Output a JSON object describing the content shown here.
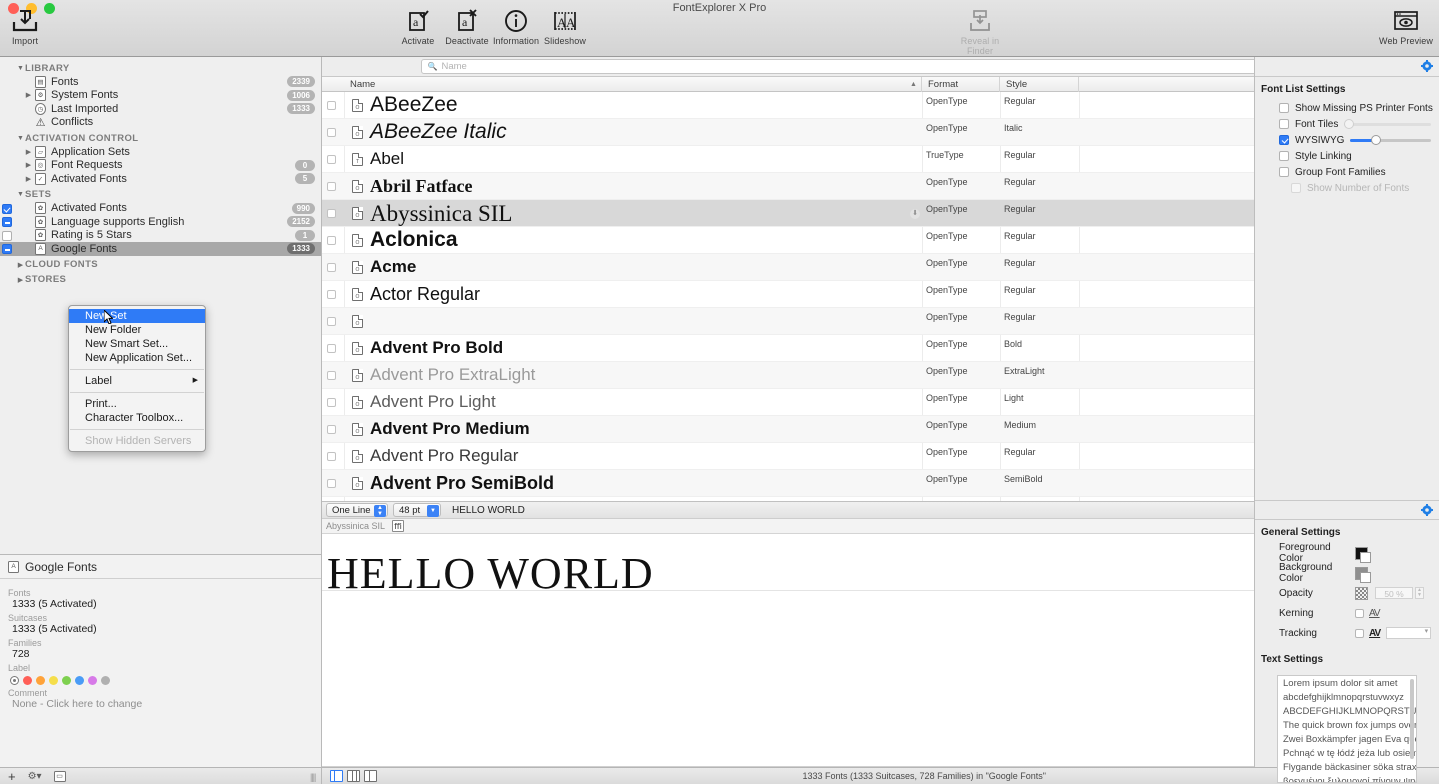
{
  "window": {
    "title": "FontExplorer X Pro"
  },
  "toolbar": {
    "items": [
      {
        "label": "Import",
        "icon": "import-icon",
        "enabled": true
      },
      {
        "label": "Activate",
        "icon": "activate-icon",
        "enabled": true
      },
      {
        "label": "Deactivate",
        "icon": "deactivate-icon",
        "enabled": true
      },
      {
        "label": "Information",
        "icon": "information-icon",
        "enabled": true
      },
      {
        "label": "Slideshow",
        "icon": "slideshow-icon",
        "enabled": true
      },
      {
        "label": "Reveal in Finder",
        "icon": "reveal-icon",
        "enabled": false
      },
      {
        "label": "Web Preview",
        "icon": "web-preview-icon",
        "enabled": true
      }
    ]
  },
  "sidebar": {
    "groups": [
      {
        "label": "LIBRARY",
        "expanded": true,
        "items": [
          {
            "label": "Fonts",
            "icon": "fonts-icon",
            "count": "2339",
            "disclosure": false,
            "checkbox": null,
            "selected": false
          },
          {
            "label": "System Fonts",
            "icon": "system-fonts-icon",
            "count": "1006",
            "disclosure": true,
            "checkbox": null,
            "selected": false
          },
          {
            "label": "Last Imported",
            "icon": "clock-icon",
            "count": "1333",
            "disclosure": false,
            "checkbox": null,
            "selected": false
          },
          {
            "label": "Conflicts",
            "icon": "warning-icon",
            "count": "",
            "disclosure": false,
            "checkbox": null,
            "selected": false
          }
        ]
      },
      {
        "label": "ACTIVATION CONTROL",
        "expanded": true,
        "items": [
          {
            "label": "Application Sets",
            "icon": "app-sets-icon",
            "count": "",
            "disclosure": true,
            "checkbox": null,
            "selected": false
          },
          {
            "label": "Font Requests",
            "icon": "font-requests-icon",
            "count": "0",
            "disclosure": true,
            "checkbox": null,
            "selected": false
          },
          {
            "label": "Activated Fonts",
            "icon": "activated-icon",
            "count": "5",
            "disclosure": true,
            "checkbox": null,
            "selected": false
          }
        ]
      },
      {
        "label": "SETS",
        "expanded": true,
        "items": [
          {
            "label": "Activated Fonts",
            "icon": "set-icon",
            "count": "990",
            "disclosure": false,
            "checkbox": "on",
            "selected": false
          },
          {
            "label": "Language supports English",
            "icon": "set-icon",
            "count": "2152",
            "disclosure": false,
            "checkbox": "mixed",
            "selected": false
          },
          {
            "label": "Rating is 5 Stars",
            "icon": "set-icon",
            "count": "1",
            "disclosure": false,
            "checkbox": "off",
            "selected": false
          },
          {
            "label": "Google Fonts",
            "icon": "folder-a-icon",
            "count": "1333",
            "disclosure": false,
            "checkbox": "mixed",
            "selected": true
          }
        ]
      },
      {
        "label": "CLOUD FONTS",
        "expanded": false,
        "items": []
      },
      {
        "label": "STORES",
        "expanded": false,
        "items": []
      }
    ]
  },
  "context_menu": {
    "items": [
      {
        "label": "New Set",
        "highlighted": true,
        "disabled": false,
        "submenu": false
      },
      {
        "label": "New Folder",
        "highlighted": false,
        "disabled": false,
        "submenu": false
      },
      {
        "label": "New Smart Set...",
        "highlighted": false,
        "disabled": false,
        "submenu": false
      },
      {
        "label": "New Application Set...",
        "highlighted": false,
        "disabled": false,
        "submenu": false
      },
      {
        "separator": true
      },
      {
        "label": "Label",
        "highlighted": false,
        "disabled": false,
        "submenu": true
      },
      {
        "separator": true
      },
      {
        "label": "Print...",
        "highlighted": false,
        "disabled": false,
        "submenu": false
      },
      {
        "label": "Character Toolbox...",
        "highlighted": false,
        "disabled": false,
        "submenu": false
      },
      {
        "separator": true
      },
      {
        "label": "Show Hidden Servers",
        "highlighted": false,
        "disabled": true,
        "submenu": false
      }
    ]
  },
  "info_panel": {
    "title": "Google Fonts",
    "icon": "folder-a-icon",
    "fields": [
      {
        "key": "Fonts",
        "value": "1333 (5 Activated)"
      },
      {
        "key": "Suitcases",
        "value": "1333 (5 Activated)"
      },
      {
        "key": "Families",
        "value": "728"
      }
    ],
    "label_key": "Label",
    "label_swatches": [
      "none",
      "#ff5f57",
      "#ffa33a",
      "#f5de4b",
      "#7ed04f",
      "#4a9cf6",
      "#d77ae8",
      "#b0b0b0"
    ],
    "comment_key": "Comment",
    "comment_value": "None - Click here to change"
  },
  "bottom_left_bar": {
    "buttons": [
      {
        "icon": "plus-icon"
      },
      {
        "icon": "gear-dropdown-icon"
      },
      {
        "icon": "box-icon"
      }
    ]
  },
  "search": {
    "placeholder": "Name",
    "icon": "search-icon",
    "value": ""
  },
  "font_table": {
    "columns": [
      {
        "label": "Name",
        "sorted": true,
        "sort_dir": "asc"
      },
      {
        "label": "Format",
        "sorted": false,
        "sort_dir": ""
      },
      {
        "label": "Style",
        "sorted": false,
        "sort_dir": ""
      }
    ],
    "rows": [
      {
        "name": "ABeeZee",
        "format": "OpenType",
        "style": "Regular",
        "selected": false,
        "font": "sans",
        "weight": "400",
        "italic": false,
        "size": 21,
        "color": "#111",
        "badge": false
      },
      {
        "name": "ABeeZee Italic",
        "format": "OpenType",
        "style": "Italic",
        "selected": false,
        "font": "sans",
        "weight": "400",
        "italic": true,
        "size": 21,
        "color": "#111",
        "badge": false
      },
      {
        "name": "Abel",
        "format": "TrueType",
        "style": "Regular",
        "selected": false,
        "font": "sans",
        "weight": "400",
        "italic": false,
        "size": 17,
        "color": "#111",
        "badge": false
      },
      {
        "name": "Abril Fatface",
        "format": "OpenType",
        "style": "Regular",
        "selected": false,
        "font": "serif",
        "weight": "700",
        "italic": false,
        "size": 18,
        "color": "#111",
        "badge": false
      },
      {
        "name": "Abyssinica  SIL",
        "format": "OpenType",
        "style": "Regular",
        "selected": true,
        "font": "serif",
        "weight": "400",
        "italic": false,
        "size": 23,
        "color": "#111",
        "badge": true
      },
      {
        "name": "Aclonica",
        "format": "OpenType",
        "style": "Regular",
        "selected": false,
        "font": "sans",
        "weight": "700",
        "italic": false,
        "size": 21,
        "color": "#111",
        "badge": false
      },
      {
        "name": "Acme",
        "format": "OpenType",
        "style": "Regular",
        "selected": false,
        "font": "sans",
        "weight": "700",
        "italic": false,
        "size": 17,
        "color": "#111",
        "badge": false
      },
      {
        "name": "Actor Regular",
        "format": "OpenType",
        "style": "Regular",
        "selected": false,
        "font": "sans",
        "weight": "400",
        "italic": false,
        "size": 18,
        "color": "#111",
        "badge": false
      },
      {
        "name": "",
        "format": "OpenType",
        "style": "Regular",
        "selected": false,
        "font": "sans",
        "weight": "400",
        "italic": false,
        "size": 15,
        "color": "#111",
        "badge": false
      },
      {
        "name": "Advent Pro Bold",
        "format": "OpenType",
        "style": "Bold",
        "selected": false,
        "font": "sans",
        "weight": "700",
        "italic": false,
        "size": 17,
        "color": "#111",
        "badge": false
      },
      {
        "name": "Advent Pro ExtraLight",
        "format": "OpenType",
        "style": "ExtraLight",
        "selected": false,
        "font": "sans",
        "weight": "400",
        "italic": false,
        "size": 17,
        "color": "#9a9a9a",
        "badge": false
      },
      {
        "name": "Advent Pro Light",
        "format": "OpenType",
        "style": "Light",
        "selected": false,
        "font": "sans",
        "weight": "400",
        "italic": false,
        "size": 17,
        "color": "#5c5c5c",
        "badge": false
      },
      {
        "name": "Advent Pro Medium",
        "format": "OpenType",
        "style": "Medium",
        "selected": false,
        "font": "sans",
        "weight": "700",
        "italic": false,
        "size": 17,
        "color": "#222",
        "badge": false
      },
      {
        "name": "Advent Pro Regular",
        "format": "OpenType",
        "style": "Regular",
        "selected": false,
        "font": "sans",
        "weight": "400",
        "italic": false,
        "size": 17,
        "color": "#3a3a3a",
        "badge": false
      },
      {
        "name": "Advent Pro SemiBold",
        "format": "OpenType",
        "style": "SemiBold",
        "selected": false,
        "font": "sans",
        "weight": "700",
        "italic": false,
        "size": 18,
        "color": "#111",
        "badge": false
      }
    ]
  },
  "preview": {
    "mode_label": "One Line",
    "size_label": "48 pt",
    "sample_text": "HELLO WORLD",
    "font_name": "Abyssinica SIL",
    "ligature_icon": "ffi-icon",
    "rendered_text": "HELLO WORLD"
  },
  "status_bar": {
    "view_toggles": [
      "view-list-icon",
      "view-columns-icon",
      "view-tiles-icon"
    ],
    "text": "1333 Fonts (1333 Suitcases, 728 Families) in \"Google Fonts\""
  },
  "font_list_settings": {
    "gear_icon": "gear-icon",
    "title": "Font List Settings",
    "options": [
      {
        "label": "Show Missing PS Printer Fonts",
        "checked": false,
        "disabled": false,
        "slider": null
      },
      {
        "label": "Font Tiles",
        "checked": false,
        "disabled": false,
        "slider": {
          "value": 0,
          "enabled": false
        }
      },
      {
        "label": "WYSIWYG",
        "checked": true,
        "disabled": false,
        "slider": {
          "value": 25,
          "enabled": true
        }
      },
      {
        "label": "Style Linking",
        "checked": false,
        "disabled": false,
        "slider": null
      },
      {
        "label": "Group Font Families",
        "checked": false,
        "disabled": false,
        "slider": null
      },
      {
        "label": "Show Number of Fonts",
        "checked": false,
        "disabled": true,
        "slider": null
      }
    ]
  },
  "general_settings": {
    "gear_icon": "gear-icon",
    "title": "General Settings",
    "rows": [
      {
        "key": "Foreground Color",
        "type": "color",
        "value": "#111111"
      },
      {
        "key": "Background Color",
        "type": "color",
        "value": "#8f8f8f"
      },
      {
        "key": "Opacity",
        "type": "number",
        "value": "50 %"
      },
      {
        "key": "Kerning",
        "type": "checkbox",
        "value": "AV",
        "checked": false
      },
      {
        "key": "Tracking",
        "type": "checkbox",
        "value": "AV",
        "checked": false,
        "field": ""
      }
    ]
  },
  "text_settings": {
    "title": "Text Settings",
    "items": [
      "Lorem ipsum dolor sit amet",
      "abcdefghijklmnopqrstuvwxyz",
      "ABCDEFGHIJKLMNOPQRSTUVWX",
      "The quick brown fox jumps over a",
      "Zwei Boxkämpfer jagen Eva quer d",
      "Pchnąć w tę łódź jeża lub osiem sk",
      "Flygande bäckasiner söka strax hv",
      "βρεγμένοι ξυλουργοί πίνουν ψηφια"
    ]
  }
}
